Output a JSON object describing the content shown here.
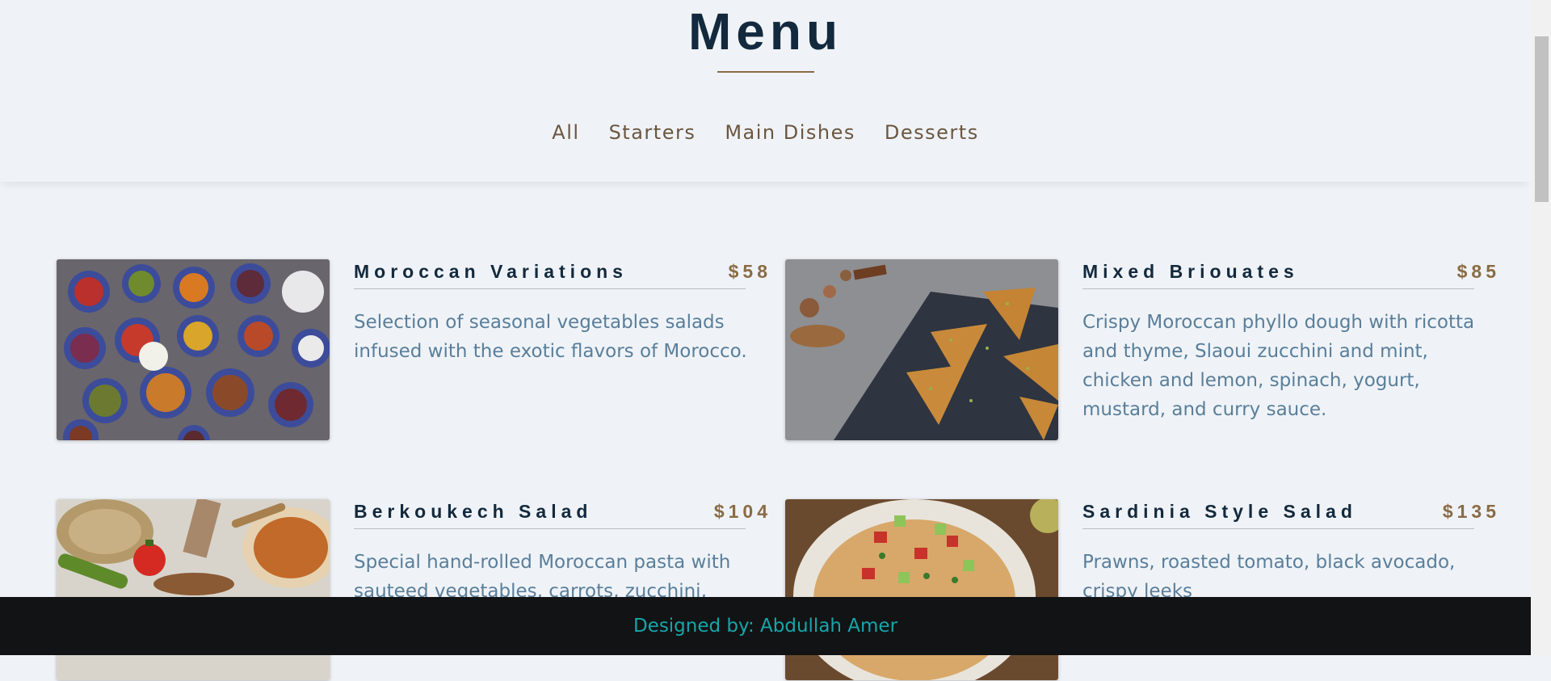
{
  "header": {
    "title": "Menu",
    "tabs": [
      "All",
      "Starters",
      "Main Dishes",
      "Desserts"
    ]
  },
  "items": [
    {
      "name": "Moroccan Variations",
      "price": "$58",
      "description": "Selection of seasonal vegetables salads infused with the exotic flavors of Morocco."
    },
    {
      "name": "Mixed Briouates",
      "price": "$85",
      "description": "Crispy Moroccan phyllo dough with ricotta and thyme, Slaoui zucchini and mint, chicken and lemon, spinach, yogurt, mustard, and curry sauce."
    },
    {
      "name": "Berkoukech Salad",
      "price": "$104",
      "description": "Special hand-rolled Moroccan pasta with sauteed vegetables, carrots, zucchini, white"
    },
    {
      "name": "Sardinia Style Salad",
      "price": "$135",
      "description": "Prawns, roasted tomato, black avocado, crispy leeks"
    }
  ],
  "footer": {
    "credit": "Designed by: Abdullah Amer"
  },
  "colors": {
    "background": "#eff3f7",
    "heading": "#13293d",
    "accent": "#8b6b45",
    "body_text": "#5a7e9a",
    "footer_bg": "#121314",
    "footer_text": "#16a6ab"
  }
}
